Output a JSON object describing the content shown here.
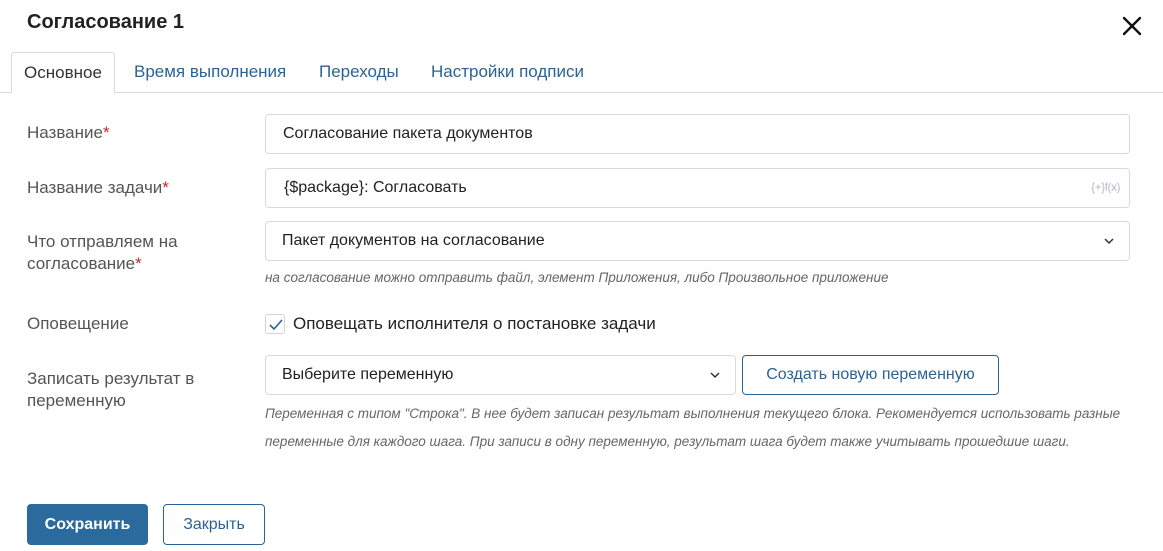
{
  "dialog": {
    "title": "Согласование 1"
  },
  "tabs": [
    {
      "label": "Основное",
      "active": true
    },
    {
      "label": "Время выполнения",
      "active": false
    },
    {
      "label": "Переходы",
      "active": false
    },
    {
      "label": "Настройки подписи",
      "active": false
    }
  ],
  "form": {
    "name": {
      "label": "Название",
      "required_mark": "*",
      "value": "Согласование пакета документов"
    },
    "task_name": {
      "label": "Название задачи",
      "required_mark": "*",
      "value": "{$package}: Согласовать",
      "func_icon_text": "{+}f(x)"
    },
    "send_for_approval": {
      "label_line1": "Что отправляем на",
      "label_line2": "согласование",
      "required_mark": "*",
      "value": "Пакет документов на согласование",
      "hint": "на согласование можно отправить файл, элемент Приложения, либо Произвольное приложение"
    },
    "notification": {
      "label": "Оповещение",
      "checkbox_label": "Оповещать исполнителя о постановке задачи",
      "checked": true
    },
    "result_variable": {
      "label_line1": "Записать результат в",
      "label_line2": "переменную",
      "placeholder": "Выберите переменную",
      "create_button": "Создать новую переменную",
      "hint_line1": "Переменная с типом \"Строка\". В нее будет записан результат выполнения текущего блока. Рекомендуется использовать разные",
      "hint_line2": "переменные для каждого шага. При записи в одну переменную, результат шага будет также учитывать прошедшие шаги."
    }
  },
  "footer": {
    "save_label": "Сохранить",
    "close_label": "Закрыть"
  },
  "colors": {
    "primary": "#2b6a9c",
    "link": "#2a6496",
    "required": "#c62828",
    "border": "#d6dadf"
  },
  "icons": {
    "close": "close-icon",
    "chevron": "chevron-down-icon",
    "check": "check-icon",
    "function": "function-icon"
  }
}
